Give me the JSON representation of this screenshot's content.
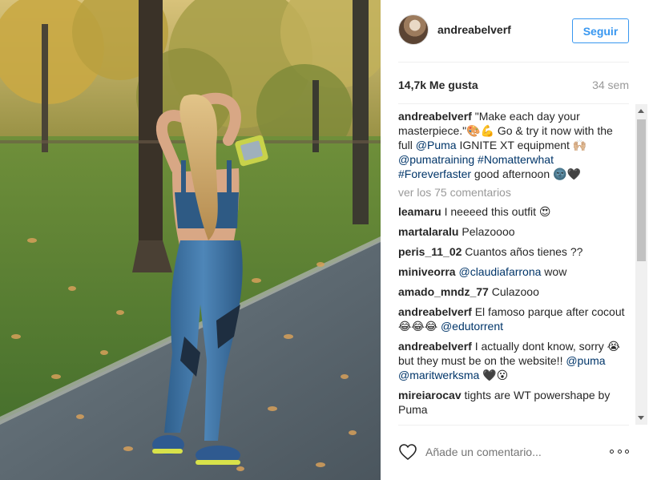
{
  "header": {
    "username": "andreabelverf",
    "follow_label": "Seguir"
  },
  "stats": {
    "likes": "14,7k Me gusta",
    "time_ago": "34 sem"
  },
  "caption": {
    "user": "andreabelverf",
    "text_1": " \"Make each day your masterpiece.\"🎨💪 Go & try it now with the full ",
    "tag_1": "@Puma",
    "text_2": " IGNITE XT equipment 🙌🏼 ",
    "tag_2": "@pumatraining",
    "text_3": " ",
    "tag_3": "#Nomatterwhat",
    "text_4": " ",
    "tag_4": "#Foreverfaster",
    "text_5": " good afternoon 🌚🖤"
  },
  "load_more": "ver los 75 comentarios",
  "comments": [
    {
      "user": "leamaru",
      "pre": " I neeeed this outfit 😍",
      "tag": "",
      "post": ""
    },
    {
      "user": "martalaralu",
      "pre": " Pelazoooo",
      "tag": "",
      "post": ""
    },
    {
      "user": "peris_11_02",
      "pre": " Cuantos años tienes ??",
      "tag": "",
      "post": ""
    },
    {
      "user": "miniveorra",
      "pre": " ",
      "tag": "@claudiafarrona",
      "post": " wow"
    },
    {
      "user": "amado_mndz_77",
      "pre": " Culazooo",
      "tag": "",
      "post": ""
    },
    {
      "user": "andreabelverf",
      "pre": " El famoso parque after cocout 😂😂😂  ",
      "tag": "@edutorrent",
      "post": ""
    },
    {
      "user": "andreabelverf",
      "pre": " I actually dont know, sorry 😭 but they must be on the website!! ",
      "tag": "@puma",
      "post": "",
      "tag2": "@maritwerksma",
      "post2": " 🖤😮"
    },
    {
      "user": "mireiarocav",
      "pre": " tights are WT powershape by Puma",
      "tag": "",
      "post": ""
    }
  ],
  "footer": {
    "comment_placeholder": "Añade un comentario..."
  },
  "colors": {
    "accent": "#3897f0",
    "link": "#003569",
    "muted": "#999999"
  }
}
